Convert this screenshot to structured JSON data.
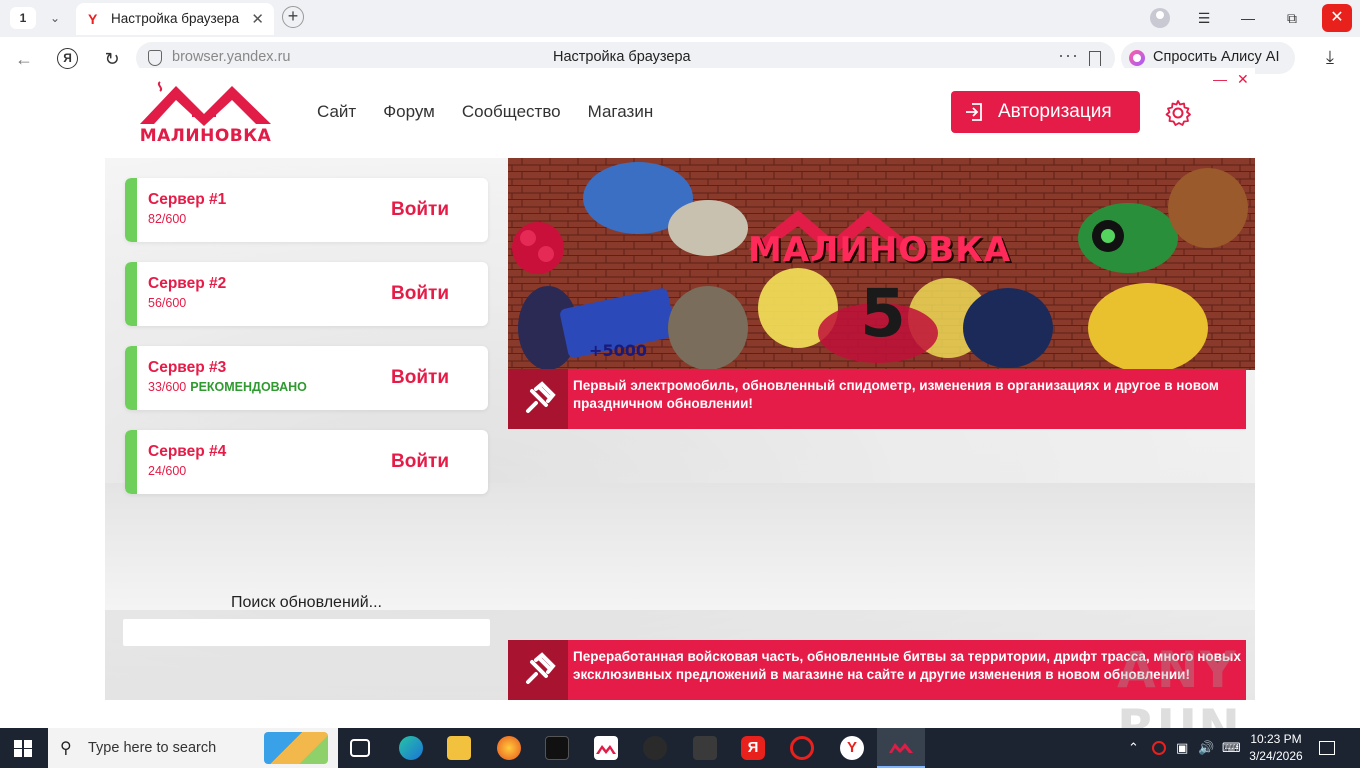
{
  "browser": {
    "tab_count": "1",
    "tab_title": "Настройка браузера",
    "address_domain": "browser.yandex.ru",
    "address_title": "Настройка браузера",
    "alice_label": "Спросить Алису AI",
    "ya_letter": "Я"
  },
  "app": {
    "logo_text": "МАЛИНОВКА",
    "nav": [
      "Сайт",
      "Форум",
      "Сообщество",
      "Магазин"
    ],
    "auth_label": "Авторизация",
    "servers": [
      {
        "name": "Сервер #1",
        "online": "82/600",
        "tag": "",
        "join": "Войти"
      },
      {
        "name": "Сервер #2",
        "online": "56/600",
        "tag": "",
        "join": "Войти"
      },
      {
        "name": "Сервер #3",
        "online": "33/600",
        "tag": "РЕКОМЕНДОВАНО",
        "join": "Войти"
      },
      {
        "name": "Сервер #4",
        "online": "24/600",
        "tag": "",
        "join": "Войти"
      }
    ],
    "update_status": "Поиск обновлений...",
    "update_progress": 0,
    "banner_title": "МАЛИНОВКА",
    "banner_number": "5",
    "banner_bonus": "+5000",
    "news": [
      {
        "text": "Первый электромобиль, обновленный спидометр, изменения в организациях и другое в новом праздничном обновлении!"
      },
      {
        "text": "Переработанная войсковая часть, обновленные битвы за территории, дрифт трасса, много новых эксклюзивных предложений в магазине на сайте и другие изменения в новом обновлении!"
      }
    ]
  },
  "watermark": "ANY RUN",
  "taskbar": {
    "search_placeholder": "Type here to search",
    "time": "10:23 PM",
    "date": "3/24/2026"
  },
  "colors": {
    "brand": "#e41c47",
    "online_bar": "#6fcf5b",
    "recommended": "#2f9a2f",
    "yandex_red": "#e8211d",
    "taskbar": "#1c2432"
  }
}
